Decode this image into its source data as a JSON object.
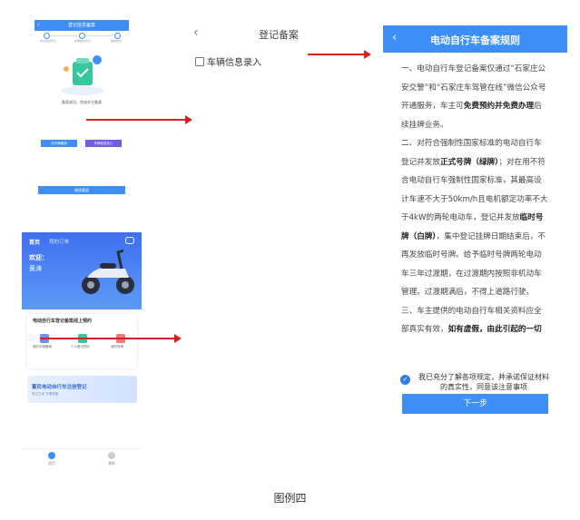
{
  "panelA": {
    "title": "登记信息备案",
    "steps": [
      "车主信息登记",
      "车辆信息登记",
      "备案成功"
    ],
    "success_msg": "备案成功，完成车主备案",
    "btn_primary": "去车辆备案",
    "btn_secondary": "车辆信息录入",
    "btn_bottom": "继续备案"
  },
  "panelB": {
    "back_icon": "‹",
    "title": "登记备案",
    "row_label": "车辆信息录入"
  },
  "panelC": {
    "back_icon": "‹",
    "title": "电动自行车备案规则",
    "para1_pre": "一、电动自行车登记备案仅通过“石家庄公安交警”和“石家庄车驾管在线”微信公众号开通服务，车主可",
    "para1_bold": "免费预约并免费办理",
    "para1_post": "后续挂牌业务。",
    "para2_pre": "二、对符合强制性国家标准的电动自行车登记并发放",
    "para2_bold1": "正式号牌（绿牌）",
    "para2_mid": "；对在用不符合电动自行车强制性国家标准，其最高设计车速不大于50km/h且电机额定功率不大于4kW的两轮电动车，登记并发放",
    "para2_bold2": "临时号牌（白牌）",
    "para2_post": "，集中登记挂牌日期结束后，不再发放临时号牌。给予临时号牌两轮电动车三年过渡期，在过渡期内按照非机动车管理。过渡期满后，不得上道路行驶。",
    "para3_pre": "三、车主提供的电动自行车相关资料应全部真实有效，",
    "para3_bold": "如有虚假，由此引起的一切",
    "agree_text": "我已充分了解各项规定，并承诺保证材料的真实性，同意该注意事项",
    "next_button": "下一步"
  },
  "panelD": {
    "tab_home": "首页",
    "tab_other": "我的订单",
    "welcome": "欢迎：",
    "username": "黄涛",
    "card_title": "电动自行车登记备案线上预约",
    "card_items": [
      "我的车辆备案",
      "个人登记预约",
      "我的号牌"
    ],
    "promo_title": "蓄民电动自行车注册登记",
    "promo_sub": "登记之家  方便快捷",
    "nav": [
      "首页",
      "我的"
    ]
  },
  "caption": "图例四",
  "colors": {
    "primary": "#3d8ff5",
    "arrow": "#d8201e"
  }
}
